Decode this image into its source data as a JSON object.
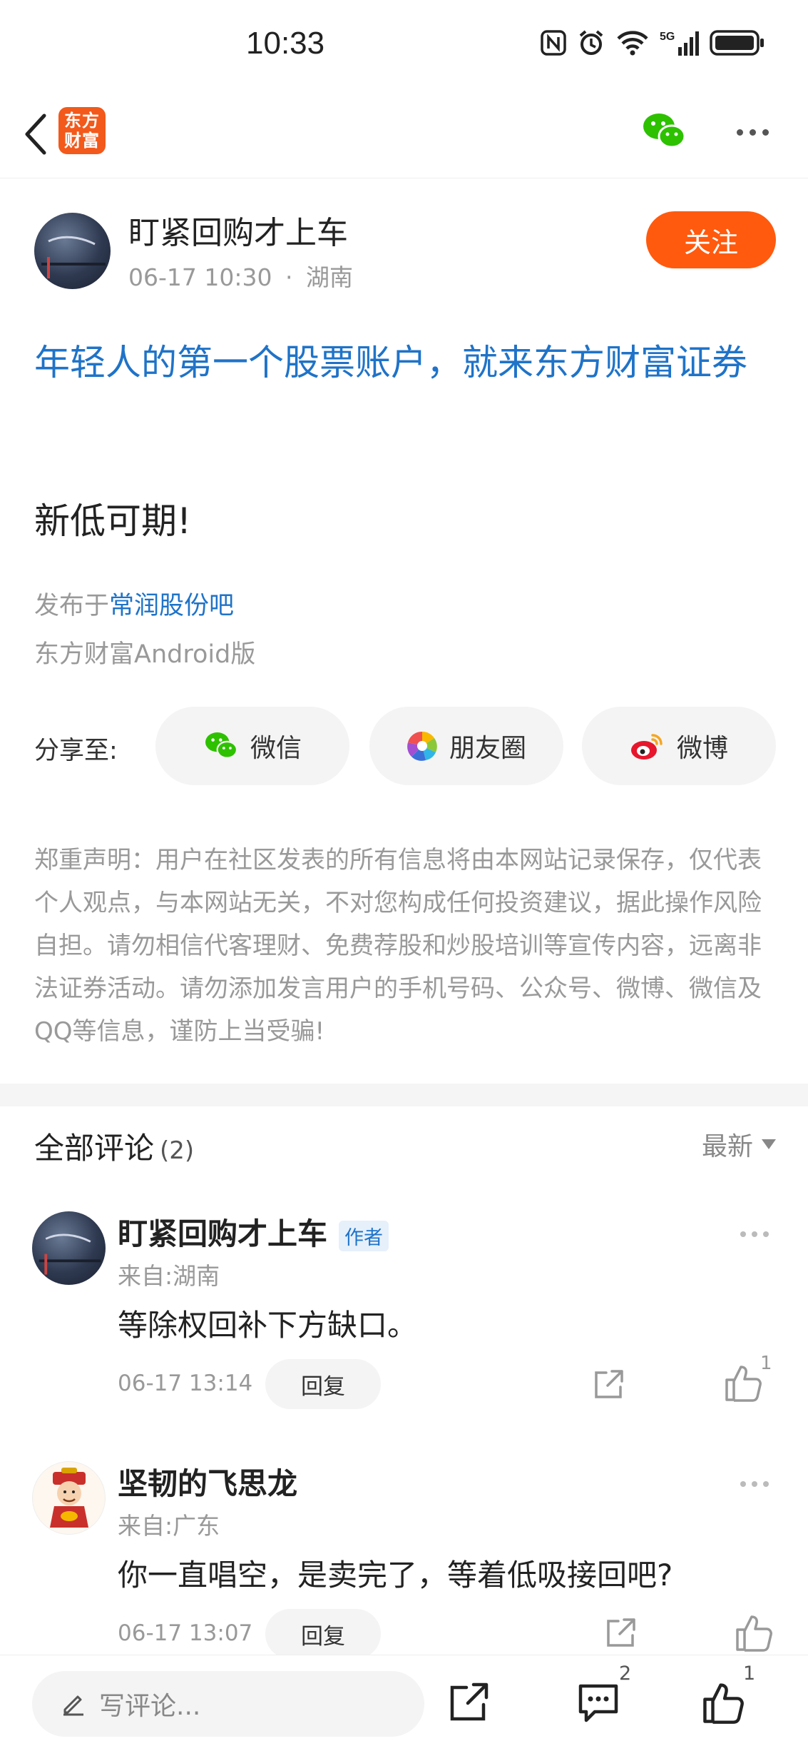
{
  "status": {
    "time": "10:33",
    "network": "5G"
  },
  "nav": {
    "logo_text": "东方\n财富"
  },
  "post": {
    "author": {
      "name": "盯紧回购才上车",
      "time": "06-17 10:30",
      "location": "湖南"
    },
    "follow_label": "关注",
    "title": "年轻人的第一个股票账户，就来东方财富证券",
    "body": "新低可期!",
    "published_prefix": "发布于",
    "published_bar": "常润股份吧",
    "client": "东方财富Android版"
  },
  "share": {
    "label": "分享至:",
    "options": [
      {
        "label": "微信",
        "icon": "wechat-icon"
      },
      {
        "label": "朋友圈",
        "icon": "moments-icon"
      },
      {
        "label": "微博",
        "icon": "weibo-icon"
      }
    ]
  },
  "disclaimer": "郑重声明：用户在社区发表的所有信息将由本网站记录保存，仅代表个人观点，与本网站无关，不对您构成任何投资建议，据此操作风险自担。请勿相信代客理财、免费荐股和炒股培训等宣传内容，远离非法证券活动。请勿添加发言用户的手机号码、公众号、微博、微信及QQ等信息，谨防上当受骗!",
  "comments": {
    "title": "全部评论",
    "count": "(2)",
    "sort_label": "最新",
    "items": [
      {
        "name": "盯紧回购才上车",
        "badge": "作者",
        "from": "来自:湖南",
        "text": "等除权回补下方缺口。",
        "time": "06-17 13:14",
        "reply_label": "回复",
        "likes": "1"
      },
      {
        "name": "坚韧的飞思龙",
        "badge": "",
        "from": "来自:广东",
        "text": "你一直唱空，是卖完了，等着低吸接回吧?",
        "time": "06-17 13:07",
        "reply_label": "回复",
        "likes": ""
      }
    ]
  },
  "bottom": {
    "placeholder": "写评论...",
    "comment_count": "2",
    "like_count": "1"
  },
  "colors": {
    "accent": "#ff5a0e",
    "link": "#1f73c8",
    "logo": "#f2591b"
  }
}
